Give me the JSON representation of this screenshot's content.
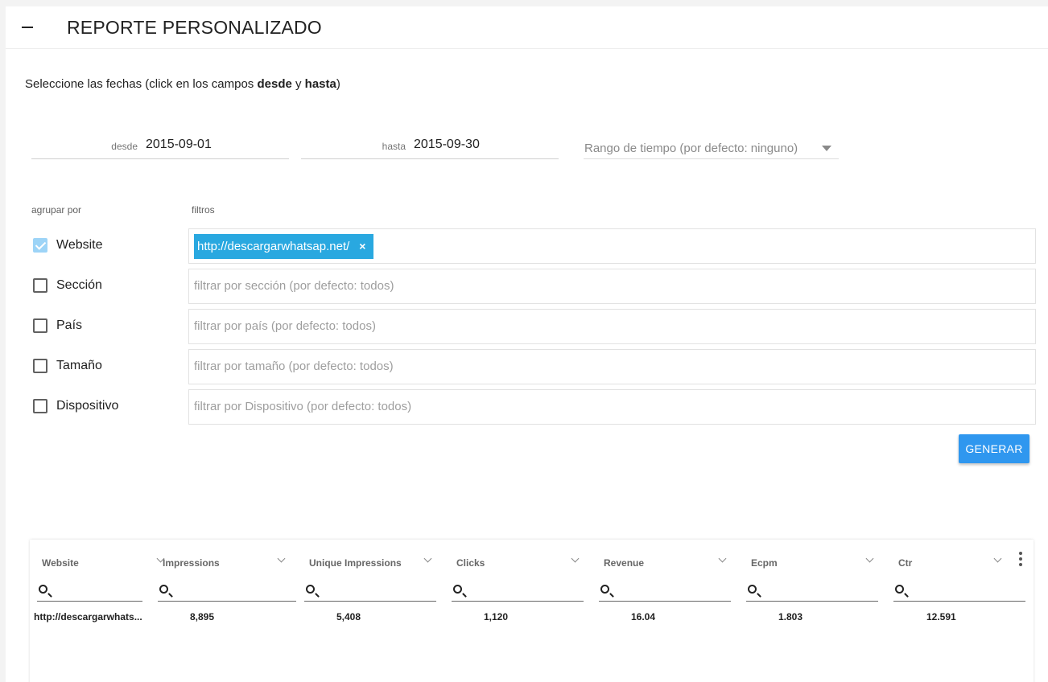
{
  "header": {
    "title": "REPORTE PERSONALIZADO"
  },
  "instructions": {
    "prefix": "Seleccione las fechas (click en los campos ",
    "bold1": "desde",
    "mid": " y ",
    "bold2": "hasta",
    "suffix": ")"
  },
  "dates": {
    "desde_label": "desde",
    "desde_value": "2015-09-01",
    "hasta_label": "hasta",
    "hasta_value": "2015-09-30"
  },
  "range_select": {
    "placeholder": "Rango de tiempo (por defecto: ninguno)"
  },
  "group_by": {
    "label": "agrupar por",
    "items": [
      {
        "label": "Website",
        "checked": true
      },
      {
        "label": "Sección",
        "checked": false
      },
      {
        "label": "País",
        "checked": false
      },
      {
        "label": "Tamaño",
        "checked": false
      },
      {
        "label": "Dispositivo",
        "checked": false
      }
    ]
  },
  "filters": {
    "label": "filtros",
    "website_chip": "http://descargarwhatsap.net/",
    "chip_remove": "×",
    "placeholders": [
      "filtrar por sección (por defecto: todos)",
      "filtrar por país (por defecto: todos)",
      "filtrar por tamaño (por defecto: todos)",
      "filtrar por Dispositivo (por defecto: todos)"
    ]
  },
  "generate_button": "GENERAR",
  "table": {
    "columns": [
      "Website",
      "Impressions",
      "Unique Impressions",
      "Clicks",
      "Revenue",
      "Ecpm",
      "Ctr"
    ],
    "rows": [
      [
        "http://descargarwhats...",
        "8,895",
        "5,408",
        "1,120",
        "16.04",
        "1.803",
        "12.591"
      ]
    ]
  },
  "colors": {
    "accent": "#2f97ef",
    "chip": "#29a8e0",
    "checkbox_checked": "#9dd4f7"
  }
}
